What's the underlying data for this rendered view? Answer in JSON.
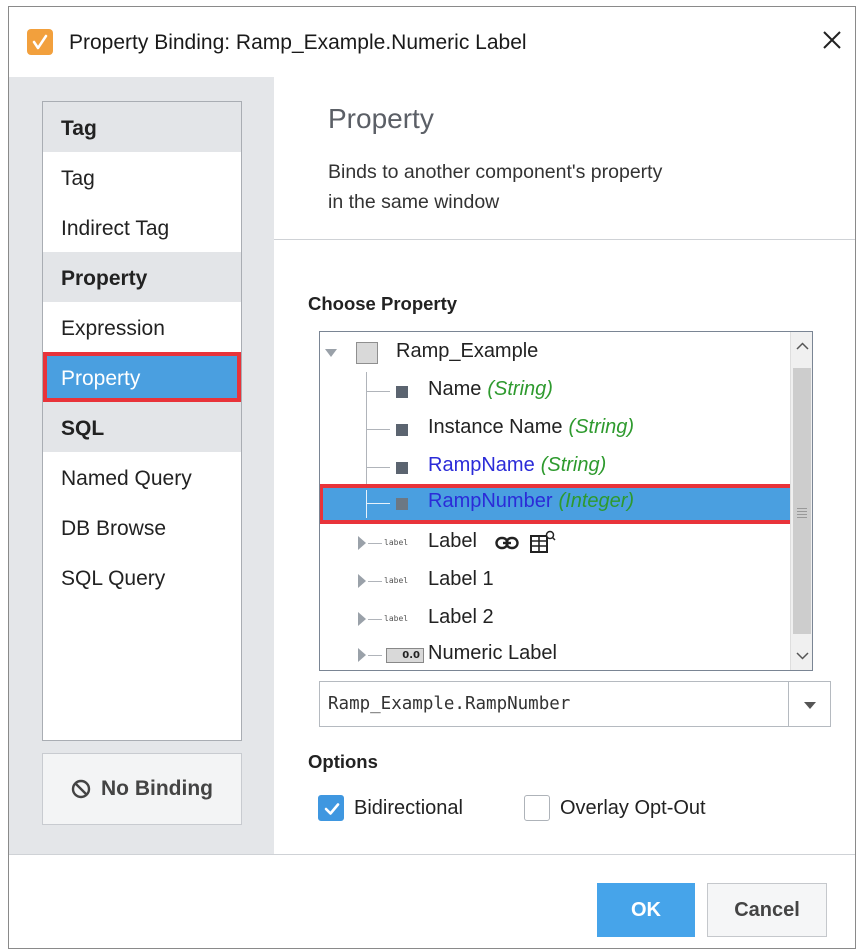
{
  "window": {
    "title": "Property Binding: Ramp_Example.Numeric Label"
  },
  "nav": {
    "groups": [
      {
        "header": "Tag",
        "items": [
          "Tag",
          "Indirect Tag"
        ]
      },
      {
        "header": "Property",
        "items": [
          "Expression",
          "Property"
        ]
      },
      {
        "header": "SQL",
        "items": [
          "Named Query",
          "DB Browse",
          "SQL Query"
        ]
      }
    ],
    "selected": "Property",
    "no_binding_label": "No Binding"
  },
  "panel": {
    "title": "Property",
    "description_line1": "Binds to another component's property",
    "description_line2": "in the same window",
    "choose_label": "Choose Property"
  },
  "tree": {
    "root": "Ramp_Example",
    "rows": [
      {
        "name": "Name",
        "type": "(String)"
      },
      {
        "name": "Instance Name",
        "type": "(String)"
      },
      {
        "name": "RampName",
        "type": "(String)",
        "custom": true
      },
      {
        "name": "RampNumber",
        "type": "(Integer)",
        "custom": true,
        "selected": true
      },
      {
        "name": "Label",
        "type": ""
      },
      {
        "name": "Label 1",
        "type": ""
      },
      {
        "name": "Label 2",
        "type": ""
      },
      {
        "name": "Numeric Label",
        "type": ""
      }
    ],
    "label_icon_text": "label",
    "numeric_icon_text": "0.0"
  },
  "selected_path": "Ramp_Example.RampNumber",
  "options": {
    "label": "Options",
    "bidirectional": {
      "label": "Bidirectional",
      "checked": true
    },
    "overlay_opt_out": {
      "label": "Overlay Opt-Out",
      "checked": false
    }
  },
  "buttons": {
    "ok": "OK",
    "cancel": "Cancel"
  },
  "colors": {
    "accent": "#46a4ea",
    "selection": "#4a9fe0",
    "highlight_border": "#e8333a",
    "type_green": "#2e9a2e",
    "custom_prop_blue": "#2b2bd8"
  }
}
